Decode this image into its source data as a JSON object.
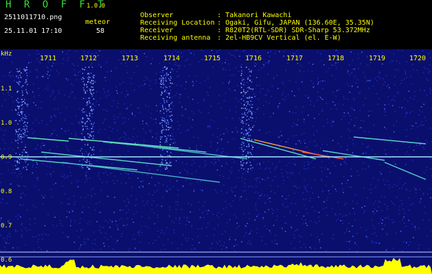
{
  "header": {
    "app_title": "H R O F F T",
    "version": "1.0.0",
    "filename": "2511011710.png",
    "datetime": "25.11.01 17:10",
    "meteor_label": "meteor",
    "meteor_count": "58"
  },
  "info": [
    {
      "key": "Observer",
      "value": ": Takanori Kawachi"
    },
    {
      "key": "Receiving Location",
      "value": ": Ogaki, Gifu, JAPAN (136.60E, 35.35N)"
    },
    {
      "key": "Receiver",
      "value": ": R820T2(RTL-SDR) SDR-Sharp 53.372MHz"
    },
    {
      "key": "Receiving antenna",
      "value": ": 2el-HB9CV Vertical (el. E-W)"
    }
  ],
  "spectrogram": {
    "y_unit": "kHz",
    "y_ticks": [
      "1.1",
      "1.0",
      "0.9",
      "0.8",
      "0.7",
      "0.6"
    ],
    "x_ticks": [
      "1711",
      "1712",
      "1713",
      "1714",
      "1715",
      "1716",
      "1717",
      "1718",
      "1719",
      "1720"
    ],
    "colors": {
      "background": "#0a0f6e",
      "noise": "#1e2db4",
      "carrier": "#9fe8ff",
      "trail": "#64e6b4",
      "hot": "#ff5040",
      "spectrum_fill": "#ffff00",
      "axis_text": "#ffff00"
    }
  }
}
